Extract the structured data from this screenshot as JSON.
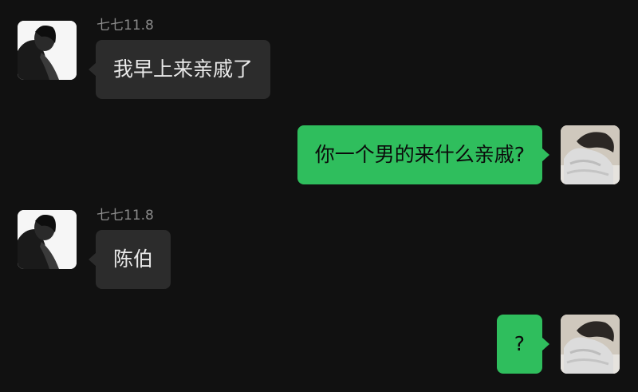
{
  "messages": [
    {
      "side": "left",
      "sender": "七七11.8",
      "text": "我早上来亲戚了",
      "avatar": "contact-avatar"
    },
    {
      "side": "right",
      "text": "你一个男的来什么亲戚?",
      "avatar": "self-avatar"
    },
    {
      "side": "left",
      "sender": "七七11.8",
      "text": "陈伯",
      "avatar": "contact-avatar"
    },
    {
      "side": "right",
      "text": "?",
      "avatar": "self-avatar"
    }
  ],
  "colors": {
    "background": "#111111",
    "incoming_bubble": "#2c2c2c",
    "outgoing_bubble": "#2fbe5d",
    "sender_name": "#8a8a8a"
  }
}
